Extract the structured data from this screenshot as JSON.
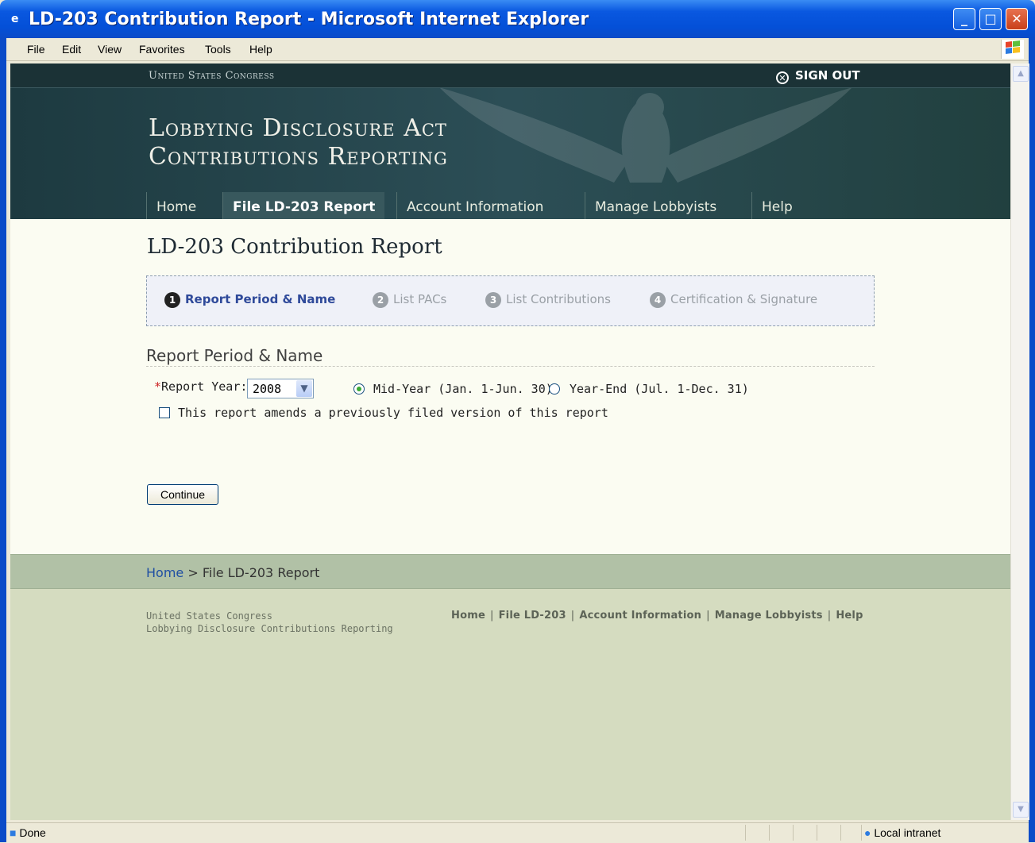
{
  "window": {
    "title": "LD-203 Contribution Report - Microsoft Internet Explorer",
    "minimize": "_",
    "maximize": "□",
    "close": "✕"
  },
  "menu": [
    "File",
    "Edit",
    "View",
    "Favorites",
    "Tools",
    "Help"
  ],
  "header": {
    "org": "United States Congress",
    "signout": "SIGN OUT",
    "title_line1": "Lobbying Disclosure Act",
    "title_line2": "Contributions Reporting",
    "nav": [
      "Home",
      "File LD-203 Report",
      "Account Information",
      "Manage Lobbyists",
      "Help"
    ],
    "active_nav": "File LD-203 Report"
  },
  "page": {
    "title": "LD-203 Contribution Report",
    "steps": [
      {
        "num": "1",
        "label": "Report Period & Name"
      },
      {
        "num": "2",
        "label": "List PACs"
      },
      {
        "num": "3",
        "label": "List Contributions"
      },
      {
        "num": "4",
        "label": "Certification & Signature"
      }
    ],
    "section_title": "Report Period & Name",
    "required_mark": "*",
    "report_year_label": "Report Year:",
    "report_year_value": "2008",
    "mid_year_label": "Mid-Year (Jan. 1-Jun. 30)",
    "year_end_label": "Year-End (Jul. 1-Dec. 31)",
    "amend_label": "This report amends a previously filed version of this report",
    "continue_label": "Continue"
  },
  "breadcrumb": {
    "home": "Home",
    "separator": " > ",
    "current": "File LD-203 Report"
  },
  "footer": {
    "line1": "United States Congress",
    "line2": "Lobbying Disclosure Contributions Reporting",
    "links": [
      "Home",
      "File LD-203",
      "Account Information",
      "Manage Lobbyists",
      "Help"
    ]
  },
  "status": {
    "text": "Done",
    "zone": "Local intranet"
  },
  "colors": {
    "accent": "#2f4a9a",
    "header": "#2c4e56",
    "footer": "#d5dcc0"
  }
}
